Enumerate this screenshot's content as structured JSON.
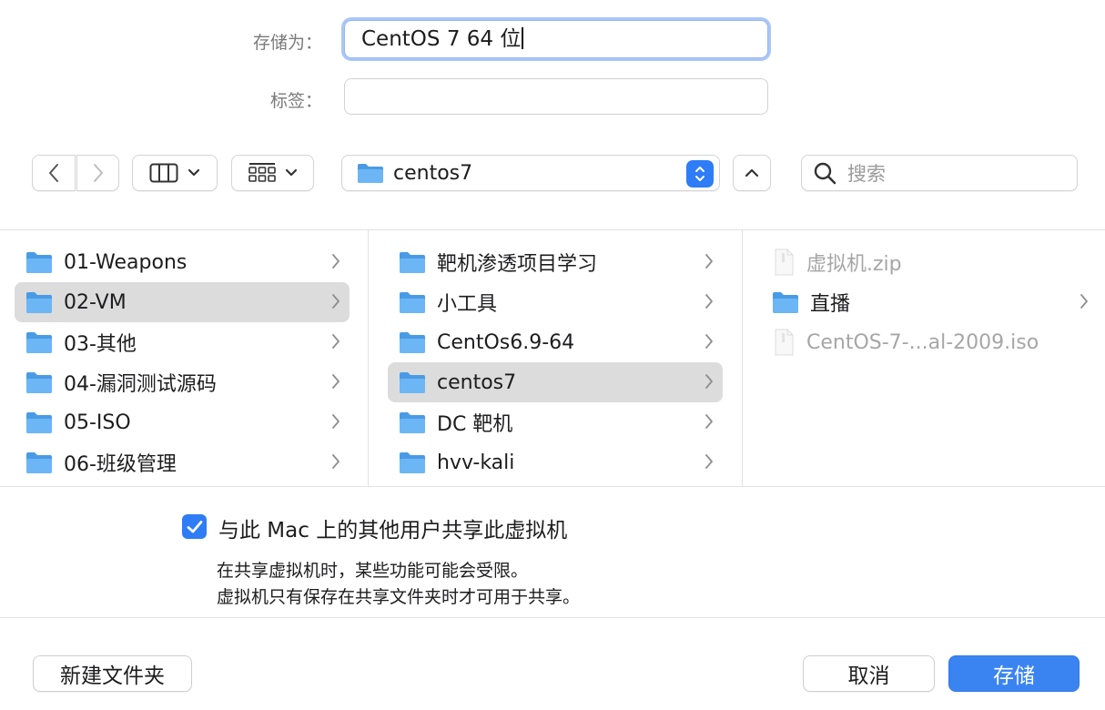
{
  "form": {
    "save_as_label": "存储为：",
    "save_as_value": "CentOS 7 64 位",
    "tags_label": "标签：",
    "tags_value": ""
  },
  "toolbar": {
    "location": "centos7",
    "search_placeholder": "搜索"
  },
  "browser": {
    "column1": [
      {
        "name": "01-Weapons",
        "type": "folder"
      },
      {
        "name": "02-VM",
        "type": "folder",
        "selected": true
      },
      {
        "name": "03-其他",
        "type": "folder"
      },
      {
        "name": "04-漏洞测试源码",
        "type": "folder"
      },
      {
        "name": "05-ISO",
        "type": "folder"
      },
      {
        "name": "06-班级管理",
        "type": "folder"
      }
    ],
    "column2": [
      {
        "name": "靶机渗透项目学习",
        "type": "folder"
      },
      {
        "name": "小工具",
        "type": "folder"
      },
      {
        "name": "CentOs6.9-64",
        "type": "folder"
      },
      {
        "name": "centos7",
        "type": "folder",
        "selected": true
      },
      {
        "name": "DC 靶机",
        "type": "folder"
      },
      {
        "name": "hvv-kali",
        "type": "folder"
      }
    ],
    "column3": [
      {
        "name": "虚拟机.zip",
        "type": "file",
        "disabled": true
      },
      {
        "name": "直播",
        "type": "folder"
      },
      {
        "name": "CentOS-7-...al-2009.iso",
        "type": "file",
        "disabled": true
      }
    ]
  },
  "options": {
    "share_checked": true,
    "share_label": "与此 Mac 上的其他用户共享此虚拟机",
    "note_line1": "在共享虚拟机时，某些功能可能会受限。",
    "note_line2": "虚拟机只有保存在共享文件夹时才可用于共享。"
  },
  "buttons": {
    "new_folder": "新建文件夹",
    "cancel": "取消",
    "save": "存储"
  },
  "colors": {
    "accent": "#2e7cf6",
    "folder": "#5aaaf0",
    "selected_row": "#dcdcdc"
  }
}
